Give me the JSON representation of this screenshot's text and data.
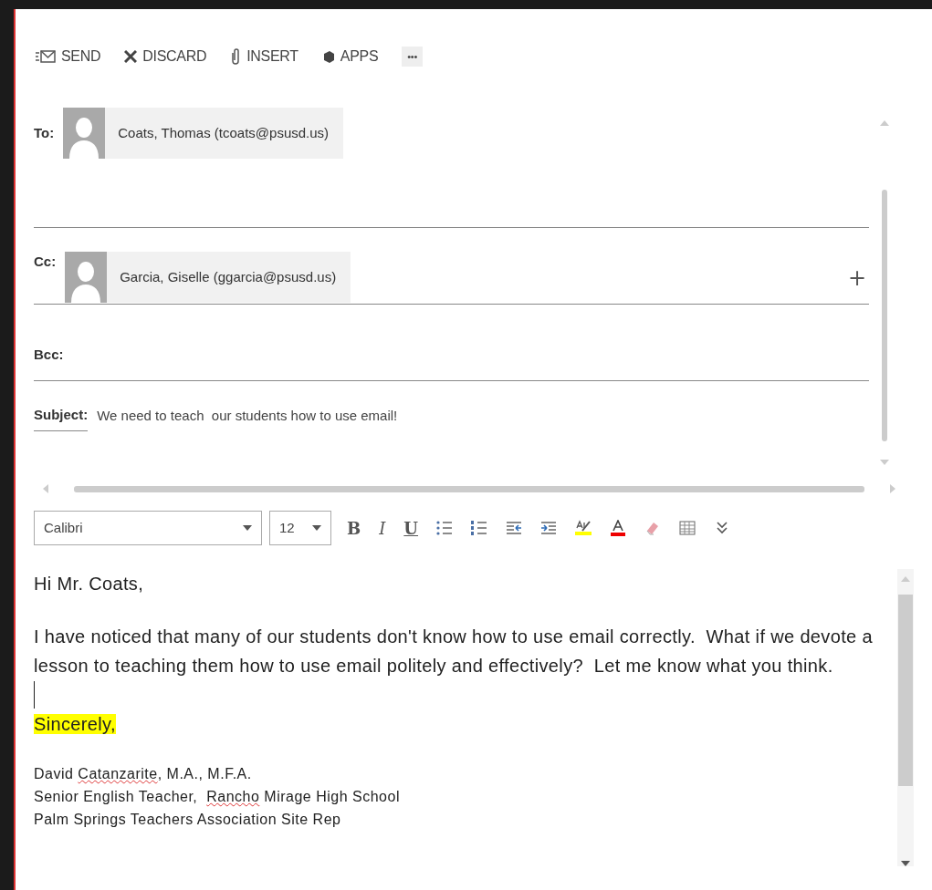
{
  "toolbar": [
    {
      "kind": "send",
      "label": "SEND"
    },
    {
      "kind": "discard",
      "label": "DISCARD"
    },
    {
      "kind": "insert",
      "label": "INSERT"
    },
    {
      "kind": "apps",
      "label": "APPS"
    },
    {
      "kind": "more",
      "label": "•••"
    }
  ],
  "to": {
    "label": "To:",
    "recipients": [
      {
        "name": "Coats, Thomas (tcoats@psusd.us)"
      }
    ]
  },
  "cc": {
    "label": "Cc:",
    "recipients": [
      {
        "name": "Garcia, Giselle (ggarcia@psusd.us)"
      }
    ],
    "add": "+"
  },
  "bcc": {
    "label": "Bcc:"
  },
  "subject": {
    "label": "Subject:",
    "value": "We need to teach  our students how to use email!"
  },
  "format_toolbar": {
    "font": "Calibri",
    "size": "12",
    "buttons": [
      {
        "kind": "bold",
        "label": "B"
      },
      {
        "kind": "italic",
        "label": "I"
      },
      {
        "kind": "underline",
        "label": "U"
      },
      {
        "kind": "bullets"
      },
      {
        "kind": "numbering"
      },
      {
        "kind": "outdent"
      },
      {
        "kind": "indent"
      },
      {
        "kind": "highlight"
      },
      {
        "kind": "font-color"
      },
      {
        "kind": "clear"
      },
      {
        "kind": "table"
      },
      {
        "kind": "expand"
      }
    ]
  },
  "body": [
    {
      "kind": "text",
      "segments": [
        {
          "text": "Hi Mr. Coats,"
        }
      ]
    },
    {
      "kind": "blank"
    },
    {
      "kind": "text",
      "segments": [
        {
          "text": "I have noticed that many of our students don't know how to use email correctly.  What if we devote a lesson to teaching them how to use email politely and effectively?  Let me know what you think."
        }
      ]
    },
    {
      "kind": "caret"
    },
    {
      "kind": "text",
      "highlighted": true,
      "segments": [
        {
          "text": "Sincerely,"
        }
      ]
    },
    {
      "kind": "blank"
    },
    {
      "kind": "small",
      "segments": [
        {
          "text": "David "
        },
        {
          "text": "Catanzarite",
          "misspelled": true
        },
        {
          "text": ", M.A., M.F.A."
        }
      ]
    },
    {
      "kind": "small",
      "segments": [
        {
          "text": "Senior English Teacher,  "
        },
        {
          "text": "Rancho",
          "misspelled": true
        },
        {
          "text": " Mirage High School"
        }
      ]
    },
    {
      "kind": "small",
      "segments": [
        {
          "text": "Palm Springs Teachers Association Site Rep"
        }
      ]
    }
  ]
}
